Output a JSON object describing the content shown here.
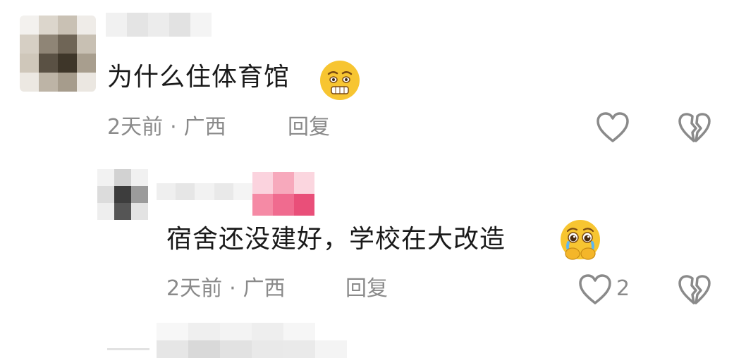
{
  "comments": [
    {
      "text": "为什么住体育馆",
      "time": "2天前",
      "separator": "·",
      "location": "广西",
      "reply_label": "回复",
      "emoji": "grimacing-face-emoji"
    },
    {
      "text": "宿舍还没建好，学校在大改造",
      "time": "2天前",
      "separator": "·",
      "location": "广西",
      "reply_label": "回复",
      "like_count": "2",
      "emoji": "holding-back-tears-emoji"
    }
  ],
  "icons": {
    "like": "heart-outline-icon",
    "dislike": "broken-heart-icon"
  },
  "colors": {
    "text": "#1a1a1a",
    "meta": "#8a8a8a",
    "emoji_yellow": "#f7c531",
    "username_pink": "#f06b8f"
  }
}
